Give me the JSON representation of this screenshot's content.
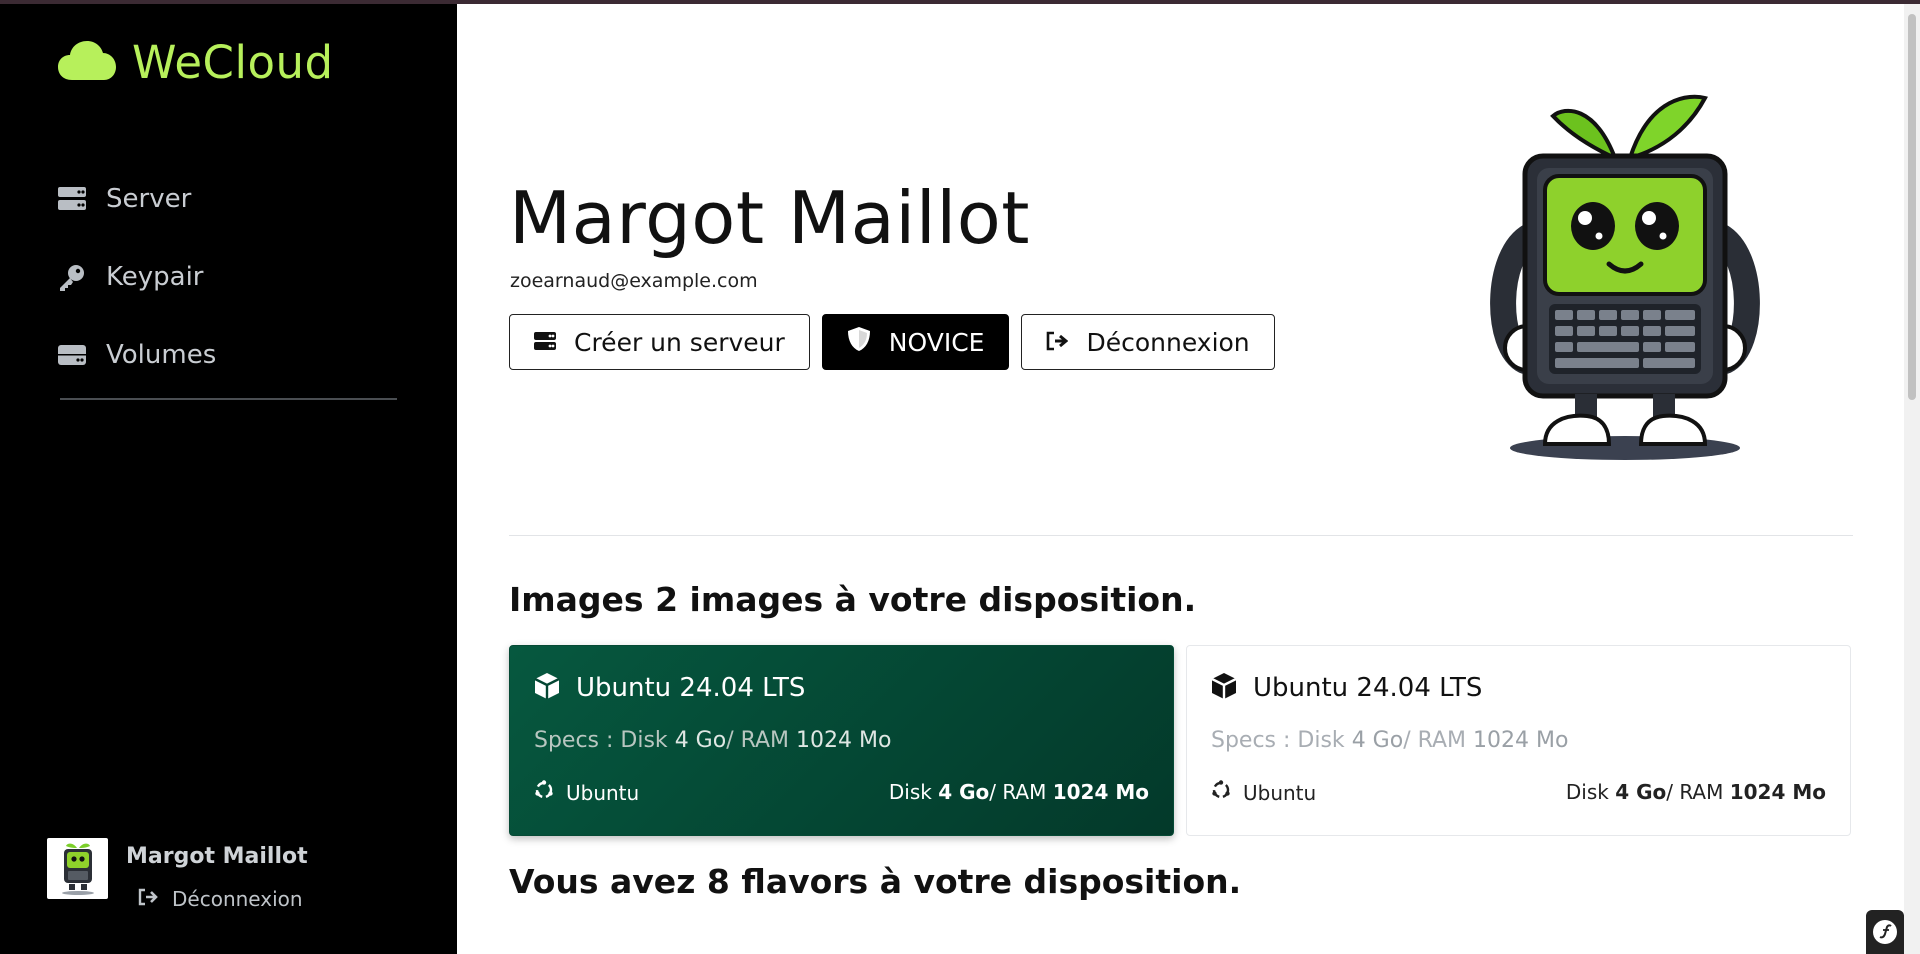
{
  "brand": {
    "name": "WeCloud",
    "accent": "#b7f05b",
    "icon": "cloud-icon"
  },
  "sidebar": {
    "items": [
      {
        "label": "Server",
        "icon": "server-icon"
      },
      {
        "label": "Keypair",
        "icon": "key-icon"
      },
      {
        "label": "Volumes",
        "icon": "hdd-icon"
      }
    ],
    "user": {
      "name": "Margot Maillot",
      "logout_label": "Déconnexion"
    }
  },
  "profile": {
    "name": "Margot Maillot",
    "email": "zoearnaud@example.com",
    "buttons": {
      "create_server": "Créer un serveur",
      "level": "NOVICE",
      "logout": "Déconnexion"
    }
  },
  "images": {
    "title_prefix": "Images",
    "title_count": "2 images",
    "title_suffix": "à votre disposition.",
    "cards": [
      {
        "name": "Ubuntu 24.04 LTS",
        "specs_prefix": "Specs : Disk",
        "disk": "4 Go",
        "ram_label": "/ RAM",
        "ram": "1024 Mo",
        "os": "Ubuntu",
        "foot_disk_label": "Disk",
        "foot_ram_label": "/ RAM",
        "selected": true
      },
      {
        "name": "Ubuntu 24.04 LTS",
        "specs_prefix": "Specs : Disk",
        "disk": "4 Go",
        "ram_label": "/ RAM",
        "ram": "1024 Mo",
        "os": "Ubuntu",
        "foot_disk_label": "Disk",
        "foot_ram_label": "/ RAM",
        "selected": false
      }
    ]
  },
  "flavors": {
    "title_prefix": "Vous avez",
    "title_count": "8 flavors",
    "title_suffix": "à votre disposition."
  },
  "colors": {
    "selected_card": "#06583f",
    "sidebar_bg": "#000000"
  }
}
